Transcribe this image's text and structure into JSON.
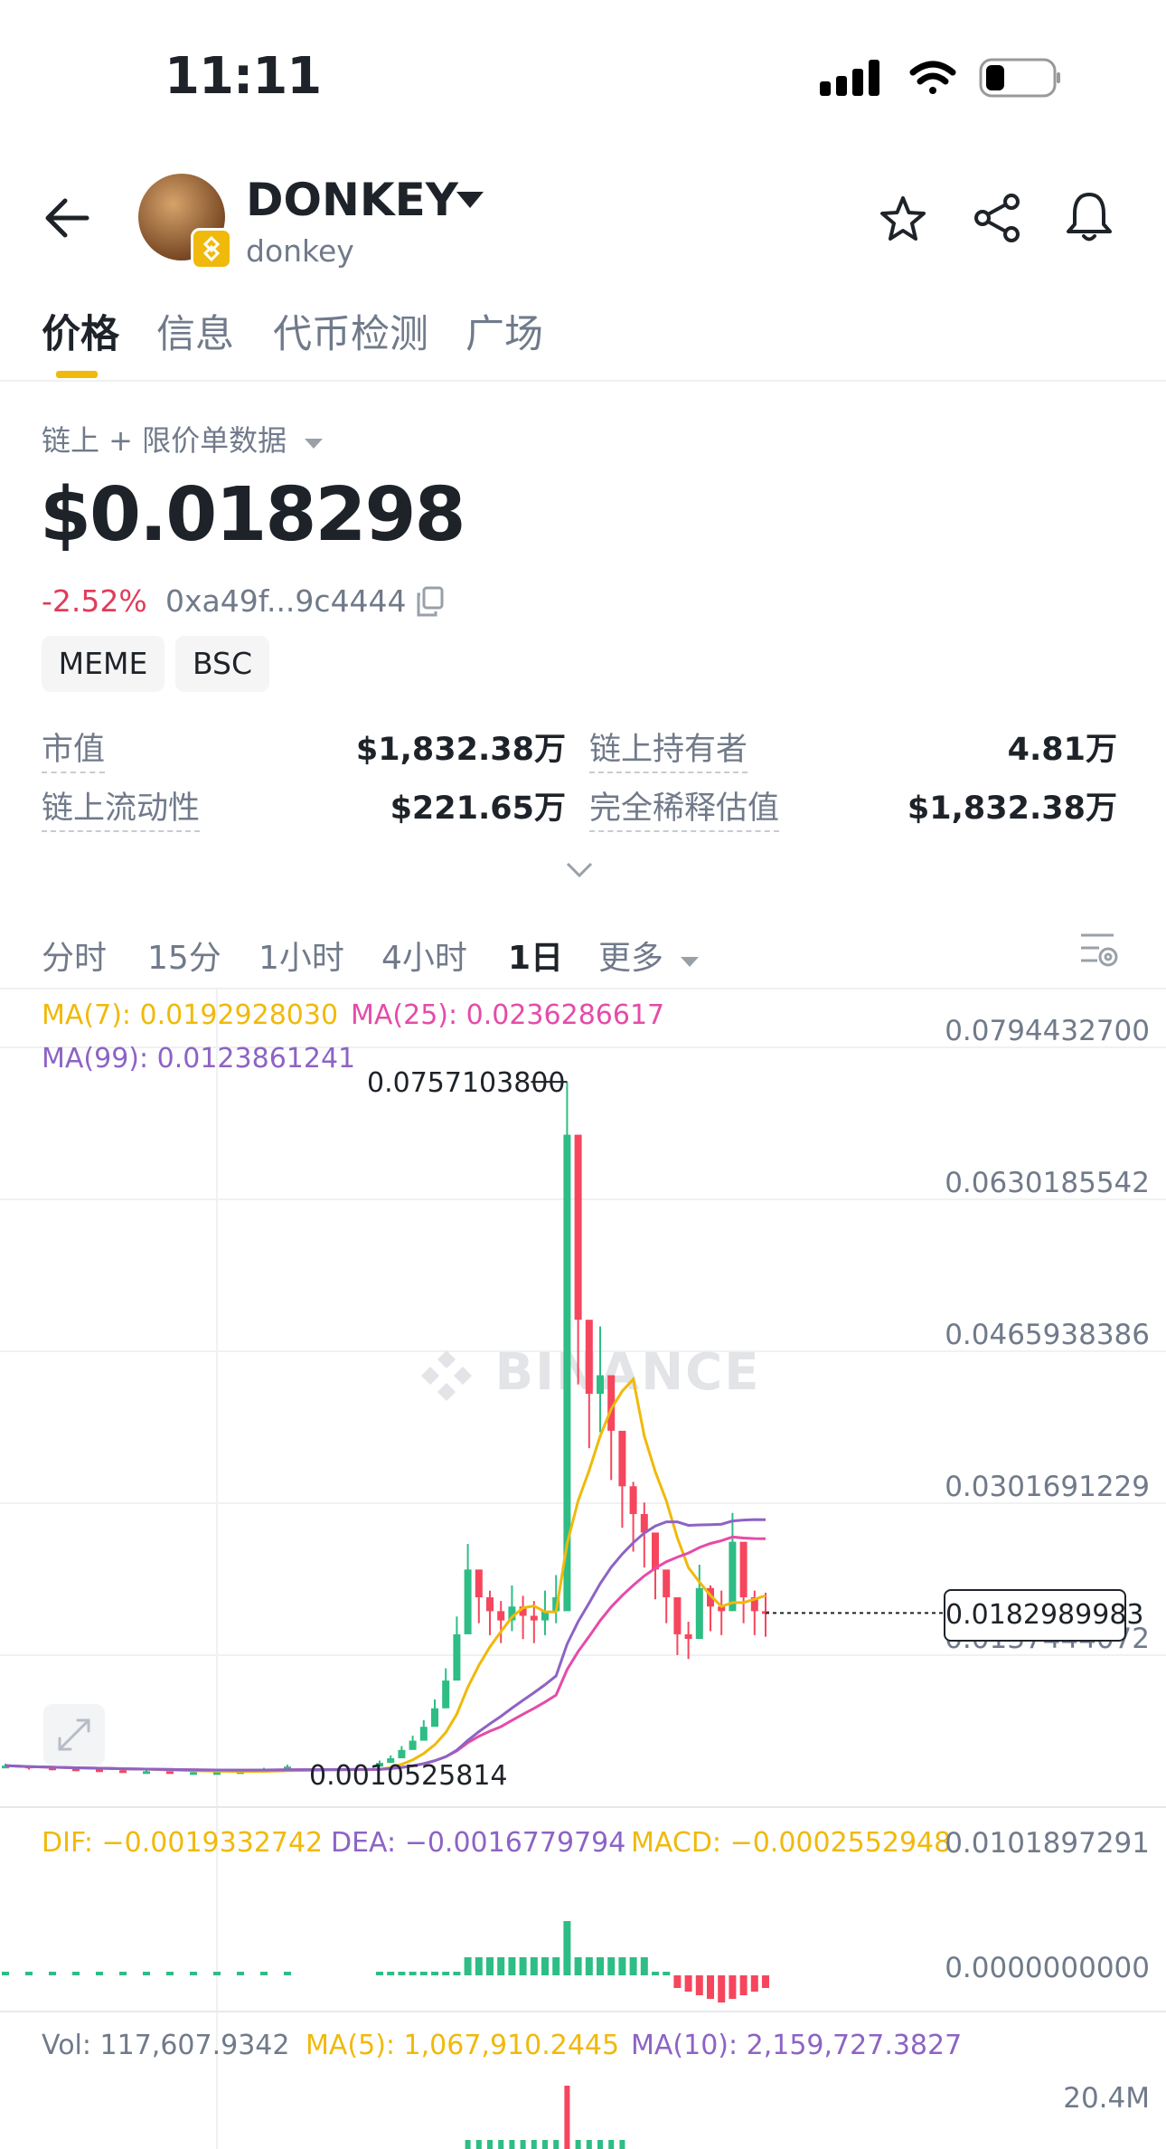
{
  "status_bar": {
    "time": "11:11"
  },
  "header": {
    "title": "DONKEY",
    "subtitle": "donkey",
    "icons": [
      "back-arrow-icon",
      "chevron-down-icon",
      "star-icon",
      "share-icon",
      "bell-icon"
    ]
  },
  "tabs": [
    {
      "label": "价格",
      "active": true
    },
    {
      "label": "信息",
      "active": false
    },
    {
      "label": "代币检测",
      "active": false
    },
    {
      "label": "广场",
      "active": false
    }
  ],
  "price_section": {
    "data_source": "链上 + 限价单数据",
    "price": "$0.018298",
    "change": "-2.52%",
    "address": "0xa49f...9c4444",
    "tags": [
      "MEME",
      "BSC"
    ],
    "change_color": "#e03c5b"
  },
  "stats": {
    "market_cap_label": "市值",
    "market_cap_value": "$1,832.38万",
    "holders_label": "链上持有者",
    "holders_value": "4.81万",
    "liquidity_label": "链上流动性",
    "liquidity_value": "$221.65万",
    "fdv_label": "完全稀释估值",
    "fdv_value": "$1,832.38万"
  },
  "timeframes": [
    {
      "label": "分时",
      "active": false
    },
    {
      "label": "15分",
      "active": false
    },
    {
      "label": "1小时",
      "active": false
    },
    {
      "label": "4小时",
      "active": false
    },
    {
      "label": "1日",
      "active": true
    },
    {
      "label": "更多",
      "active": false
    }
  ],
  "indicators": {
    "ma7": "MA(7): 0.0192928030",
    "ma25": "MA(25): 0.0236286617",
    "ma99": "MA(99): 0.0123861241",
    "dif": "DIF: −0.0019332742",
    "dea": "DEA: −0.0016779794",
    "macd": "MACD: −0.0002552948",
    "vol": "Vol: 117,607.9342",
    "vol_ma5": "MA(5): 1,067,910.2445",
    "vol_ma10": "MA(10): 2,159,727.3827"
  },
  "price_axis": [
    "0.0794432700",
    "0.0630185542",
    "0.0465938386",
    "0.0301691229",
    "0.0137444072"
  ],
  "current_price_label": "0.0182989983",
  "high_label": "0.0757103800",
  "low_label": "0.0010525814",
  "macd_axis": [
    "0.0101897291",
    "0.0000000000"
  ],
  "vol_axis": [
    "20.4M"
  ],
  "watermark": "BINANCE",
  "colors": {
    "up": "#2ebd85",
    "down": "#f6465d",
    "ma7": "#f0b90b",
    "ma25": "#e44ca8",
    "ma99": "#8d63c4",
    "accent": "#f0b90b"
  },
  "chart_data": {
    "type": "candlestick",
    "ylim": [
      0,
      0.07944327
    ],
    "high": 0.07571038,
    "low": 0.0010525814,
    "last": 0.0182989983,
    "close_series_approx": [
      0.0018,
      0.0016,
      0.0015,
      0.0014,
      0.0013,
      0.0012,
      0.0012,
      0.0011,
      0.0011,
      0.0011,
      0.0012,
      0.0014,
      0.0017,
      0.0021,
      0.0026,
      0.0035,
      0.0045,
      0.006,
      0.008,
      0.011,
      0.016,
      0.023,
      0.02,
      0.0185,
      0.0175,
      0.019,
      0.018,
      0.0175,
      0.0185,
      0.02,
      0.07,
      0.05,
      0.042,
      0.044,
      0.038,
      0.032,
      0.029,
      0.027,
      0.023,
      0.02,
      0.016,
      0.0155,
      0.021,
      0.019,
      0.0185,
      0.026,
      0.02,
      0.0185,
      0.0183
    ]
  }
}
